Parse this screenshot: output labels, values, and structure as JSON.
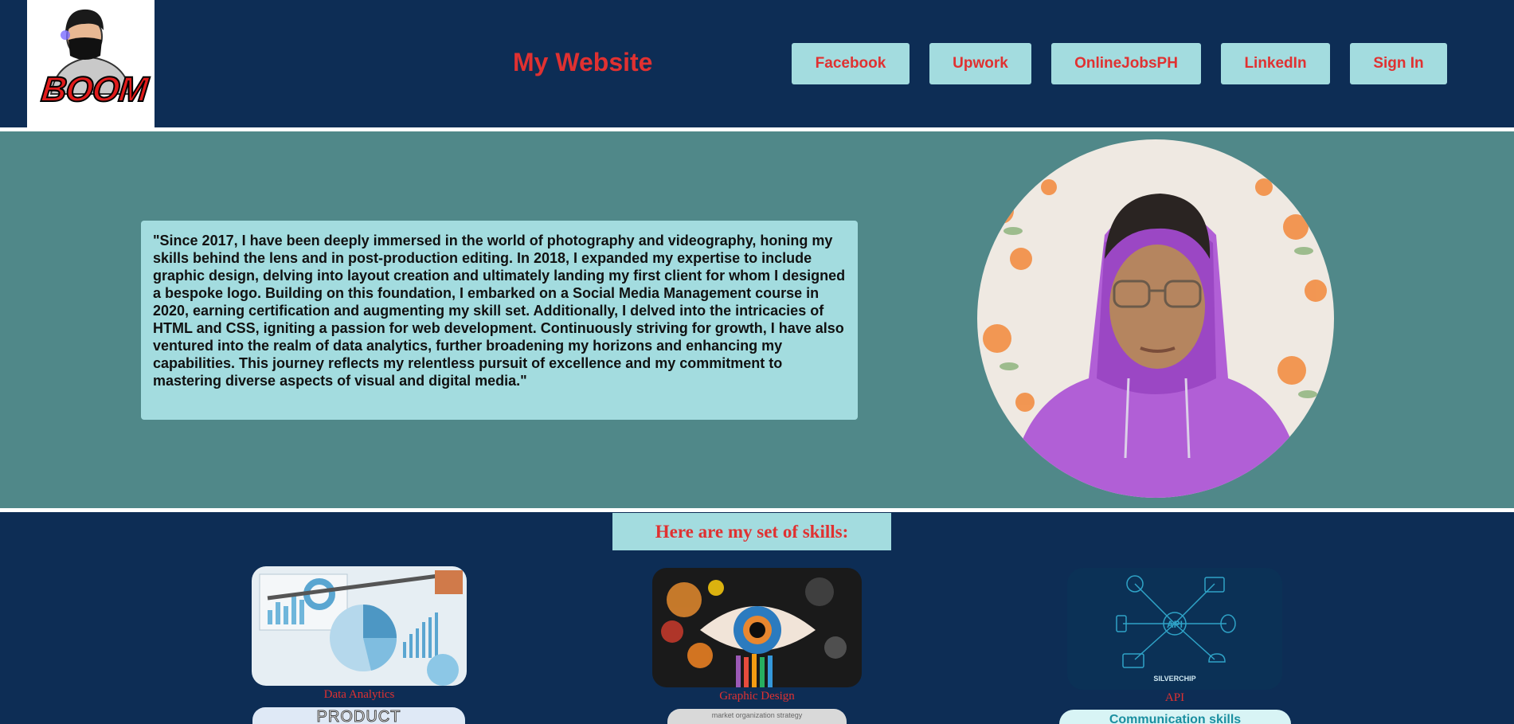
{
  "header": {
    "title": "My Website",
    "logo_text": "BOOM",
    "nav": [
      "Facebook",
      "Upwork",
      "OnlineJobsPH",
      "LinkedIn",
      "Sign In"
    ]
  },
  "hero": {
    "quote": "\"Since 2017, I have been deeply immersed in the world of photography and videography, honing my skills behind the lens and in post-production editing. In 2018, I expanded my expertise to include graphic design, delving into layout creation and ultimately landing my first client for whom I designed a bespoke logo. Building on this foundation, I embarked on a Social Media Management course in 2020, earning certification and augmenting my skill set. Additionally, I delved into the intricacies of HTML and CSS, igniting a passion for web development. Continuously striving for growth, I have also ventured into the realm of data analytics, further broadening my horizons and enhancing my capabilities. This journey reflects my relentless pursuit of excellence and my commitment to mastering diverse aspects of visual and digital media.\""
  },
  "skills": {
    "title": "Here are my set of skills:",
    "items": [
      {
        "label": "Data Analytics"
      },
      {
        "label": "Graphic Design"
      },
      {
        "label": "API",
        "img_text": "API",
        "brand_text": "SILVERCHIP"
      }
    ],
    "next_row": [
      {
        "text": "PRODUCT"
      },
      {
        "text": "market organization strategy"
      },
      {
        "text": "Communication skills"
      }
    ]
  },
  "colors": {
    "navy": "#0d2d55",
    "teal": "#508889",
    "light_cyan": "#a3dcdf",
    "accent_red": "#e03131"
  }
}
